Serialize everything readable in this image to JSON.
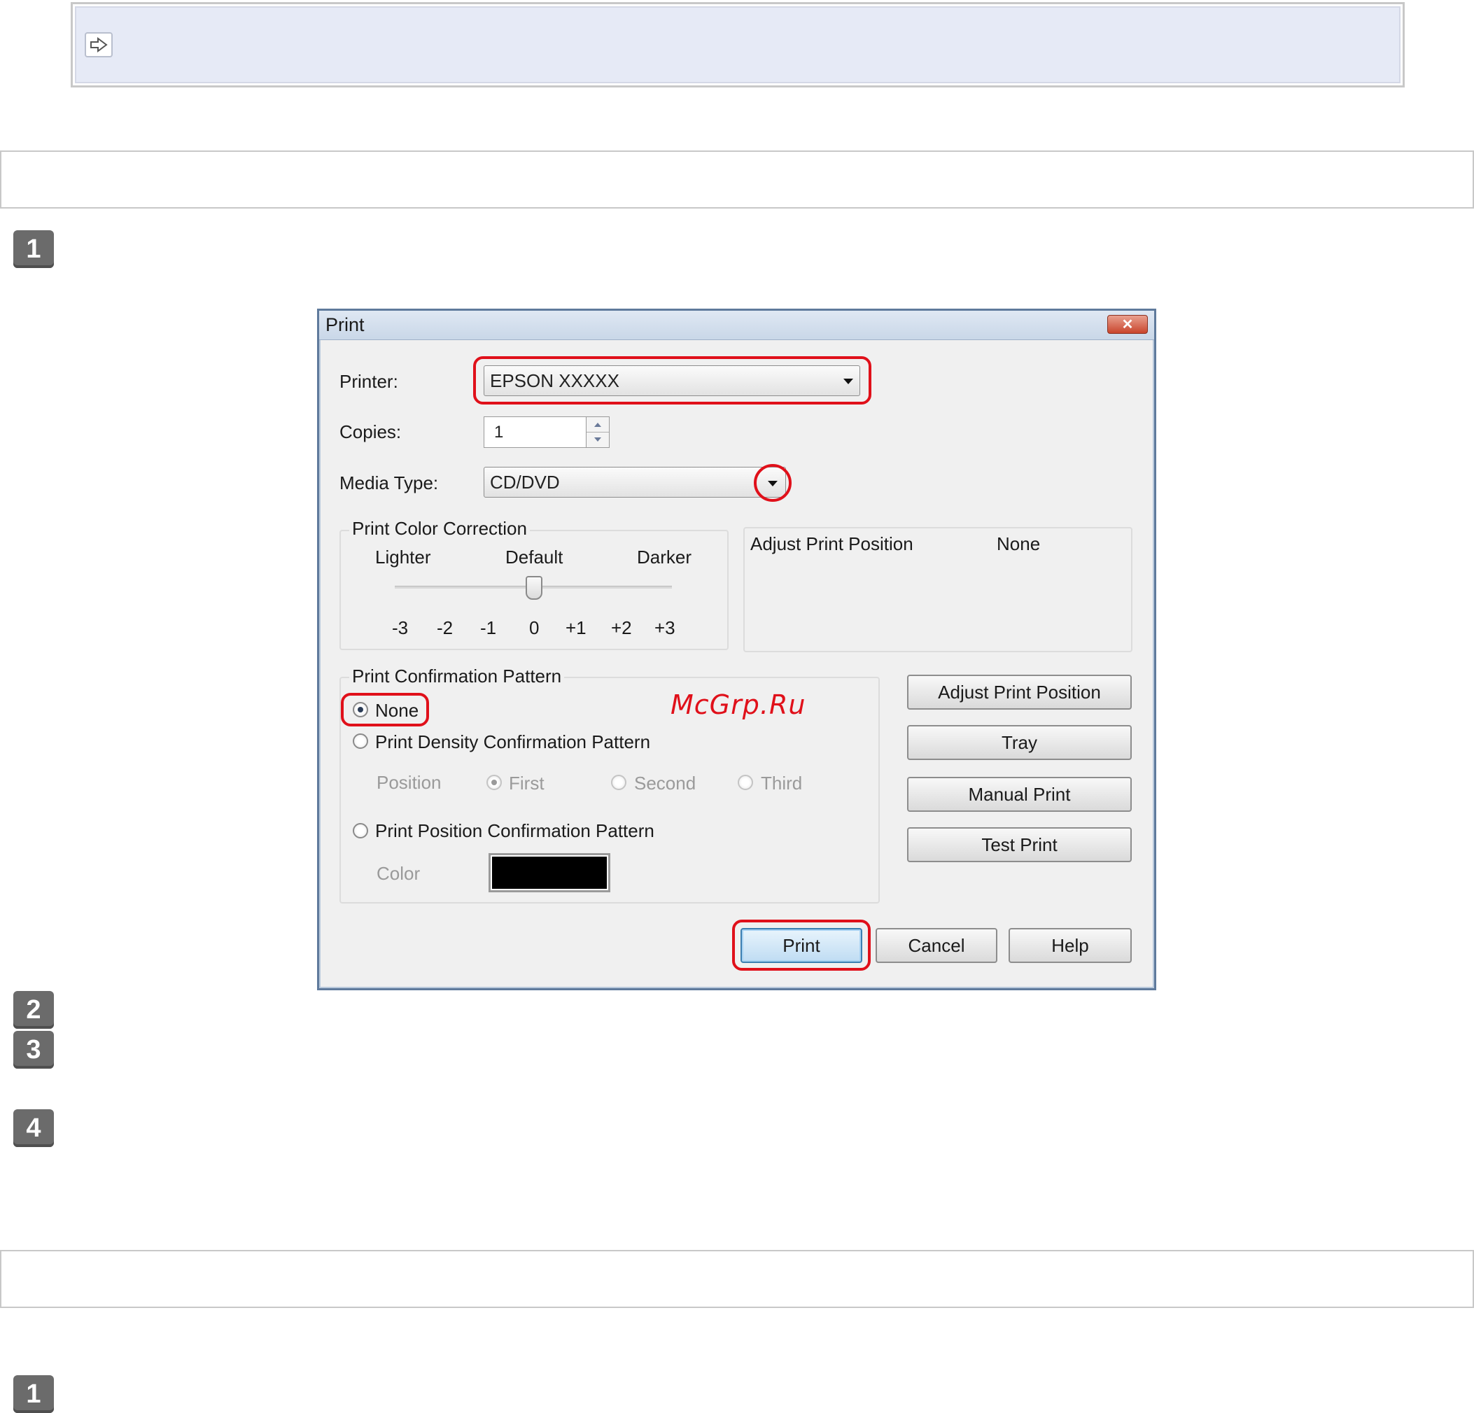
{
  "page": {
    "step_numbers": [
      "1",
      "2",
      "3",
      "4",
      "1"
    ]
  },
  "dialog": {
    "title": "Print",
    "close_symbol": "✕",
    "printer_label": "Printer:",
    "printer_value": "EPSON XXXXX",
    "copies_label": "Copies:",
    "copies_value": "1",
    "media_type_label": "Media Type:",
    "media_type_value": "CD/DVD",
    "color_correction": {
      "title": "Print Color Correction",
      "lighter": "Lighter",
      "default": "Default",
      "darker": "Darker",
      "ticks": [
        "-3",
        "-2",
        "-1",
        "0",
        "+1",
        "+2",
        "+3"
      ],
      "selected_value": "0"
    },
    "adjust_position": {
      "label": "Adjust Print Position",
      "value": "None"
    },
    "confirmation_pattern": {
      "title": "Print Confirmation Pattern",
      "none_label": "None",
      "density_label": "Print Density Confirmation Pattern",
      "position_label": "Position",
      "first_label": "First",
      "second_label": "Second",
      "third_label": "Third",
      "position_pattern_label": "Print Position Confirmation Pattern",
      "color_label": "Color",
      "color_value": "#000000",
      "selected": "None"
    },
    "side_buttons": {
      "adjust": "Adjust Print Position",
      "tray": "Tray",
      "manual": "Manual Print",
      "test": "Test Print"
    },
    "footer_buttons": {
      "print": "Print",
      "cancel": "Cancel",
      "help": "Help"
    }
  },
  "watermark": "McGrp.Ru",
  "colors": {
    "highlight_ring": "#e0101a",
    "note_background": "#e6eaf6",
    "step_badge": "#6b6b6b"
  },
  "icons": {
    "note": "arrow-right-icon",
    "dropdown": "chevron-down-icon"
  }
}
